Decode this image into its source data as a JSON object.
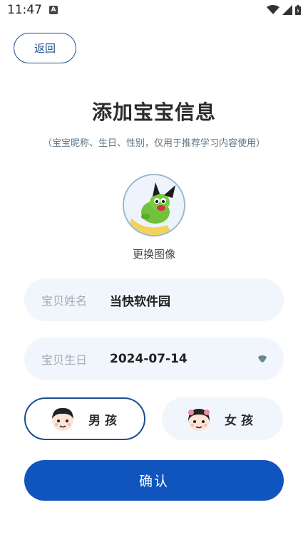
{
  "status_bar": {
    "time": "11:47",
    "notification_icon": "A",
    "icons": [
      "wifi-icon",
      "signal-icon",
      "battery-icon"
    ]
  },
  "back_button": {
    "label": "返回"
  },
  "title": "添加宝宝信息",
  "subtitle": "（宝宝昵称、生日、性别，仅用于推荐学习内容使用）",
  "avatar": {
    "change_label": "更换图像"
  },
  "name_field": {
    "label": "宝贝姓名",
    "value": "当快软件园"
  },
  "birthday_field": {
    "label": "宝贝生日",
    "value": "2024-07-14"
  },
  "gender": {
    "boy_label": "男孩",
    "girl_label": "女孩",
    "selected": "boy"
  },
  "confirm_button": {
    "label": "确认"
  },
  "colors": {
    "primary": "#1055be",
    "accent_border": "#1a4f8f",
    "field_bg": "#f0f6fb"
  }
}
